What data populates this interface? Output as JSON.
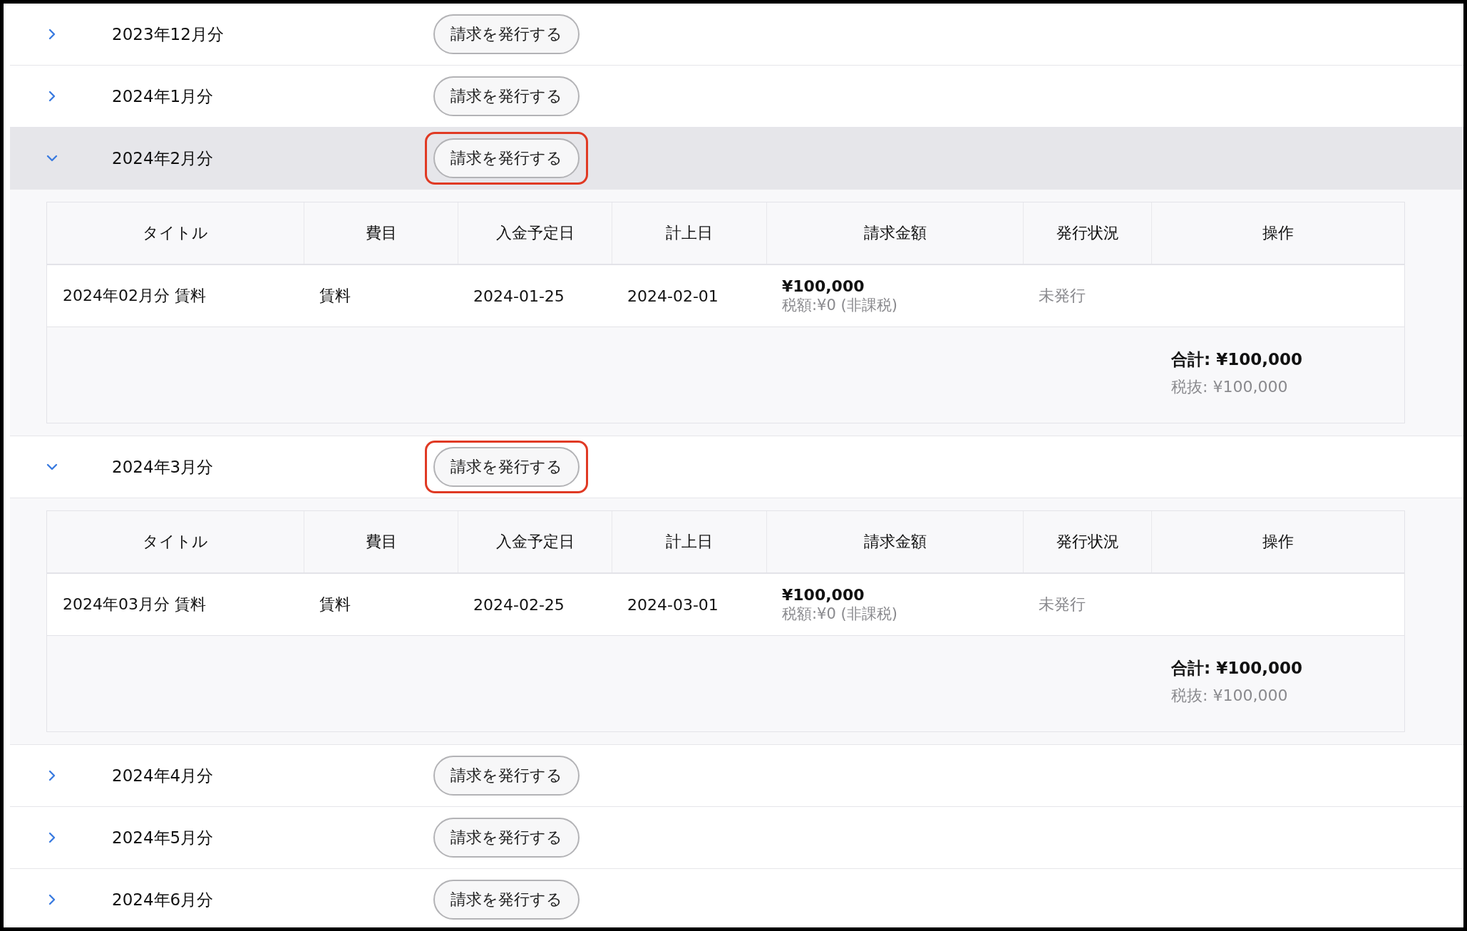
{
  "months": [
    {
      "label": "2023年12月分",
      "expanded": false,
      "active": false,
      "highlighted": false,
      "button": "請求を発行する"
    },
    {
      "label": "2024年1月分",
      "expanded": false,
      "active": false,
      "highlighted": false,
      "button": "請求を発行する"
    },
    {
      "label": "2024年2月分",
      "expanded": true,
      "active": true,
      "highlighted": true,
      "button": "請求を発行する",
      "detail": {
        "columns": [
          "タイトル",
          "費目",
          "入金予定日",
          "計上日",
          "請求金額",
          "発行状況",
          "操作"
        ],
        "rows": [
          {
            "title": "2024年02月分 賃料",
            "category": "賃料",
            "due_date": "2024-01-25",
            "posting_date": "2024-02-01",
            "amount": "¥100,000",
            "tax": "税額:¥0 (非課税)",
            "status": "未発行"
          }
        ],
        "total": "合計: ¥100,000",
        "subtotal": "税抜: ¥100,000"
      }
    },
    {
      "label": "2024年3月分",
      "expanded": true,
      "active": false,
      "highlighted": true,
      "button": "請求を発行する",
      "detail": {
        "columns": [
          "タイトル",
          "費目",
          "入金予定日",
          "計上日",
          "請求金額",
          "発行状況",
          "操作"
        ],
        "rows": [
          {
            "title": "2024年03月分 賃料",
            "category": "賃料",
            "due_date": "2024-02-25",
            "posting_date": "2024-03-01",
            "amount": "¥100,000",
            "tax": "税額:¥0 (非課税)",
            "status": "未発行"
          }
        ],
        "total": "合計: ¥100,000",
        "subtotal": "税抜: ¥100,000"
      }
    },
    {
      "label": "2024年4月分",
      "expanded": false,
      "active": false,
      "highlighted": false,
      "button": "請求を発行する"
    },
    {
      "label": "2024年5月分",
      "expanded": false,
      "active": false,
      "highlighted": false,
      "button": "請求を発行する"
    },
    {
      "label": "2024年6月分",
      "expanded": false,
      "active": false,
      "highlighted": false,
      "button": "請求を発行する"
    }
  ]
}
